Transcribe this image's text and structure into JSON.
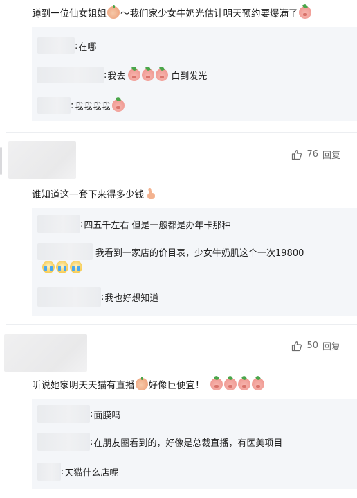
{
  "comments": [
    {
      "text_before": "蹲到一位仙女姐姐",
      "text_after": "～我们家少女牛奶光估计明天预约要爆满了",
      "replies": [
        {
          "text": "在哪"
        },
        {
          "text": "我去",
          "after_emoji": "白到发光"
        },
        {
          "text": "我我我我"
        }
      ]
    },
    {
      "like_count": "76",
      "reply_label": "回复",
      "text": "谁知道这一套下来得多少钱",
      "replies": [
        {
          "text": "四五千左右 但是一般都是办年卡那种"
        },
        {
          "text": "我看到一家店的价目表，少女牛奶肌这个一次19800"
        },
        {
          "text": "我也好想知道"
        }
      ]
    },
    {
      "like_count": "50",
      "reply_label": "回复",
      "text_before": "听说她家明天天猫有直播",
      "text_after": "好像巨便宜！",
      "replies": [
        {
          "text": "面膜吗"
        },
        {
          "text": "在朋友圈看到的，好像是总裁直播，有医美项目"
        },
        {
          "text": "天猫什么店呢"
        }
      ]
    }
  ],
  "colon": ":",
  "icons": {
    "like": "thumbs-up-icon",
    "pig": "pig-emoji-icon",
    "cry": "crying-emoji-icon",
    "melon": "melon-emoji-icon",
    "peace": "peace-hand-emoji-icon"
  },
  "colors": {
    "reply_bg": "#f4f6f9",
    "text": "#1a1a1a",
    "meta": "#6b6b6b"
  }
}
